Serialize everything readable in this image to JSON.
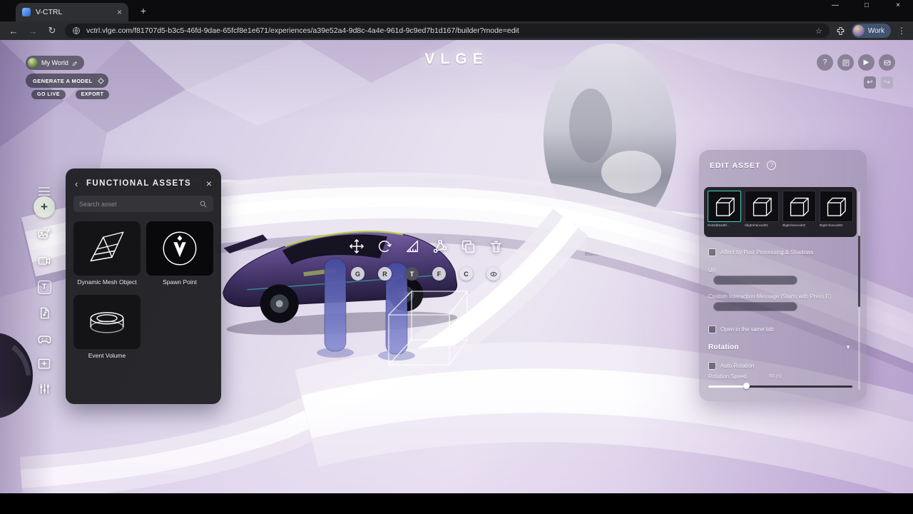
{
  "icons": {
    "close": "×",
    "minimize": "—",
    "maximize": "□",
    "menu_dots": "⋮",
    "back_nav": "←",
    "forward_nav": "→",
    "refresh": "↻",
    "star": "☆",
    "new_tab": "+",
    "back_chevron": "‹",
    "help": "?",
    "play": "▶",
    "undo": "↩",
    "redo": "↪",
    "dropdown": "▼",
    "plus": "+",
    "text_tool": "T"
  },
  "colors": {
    "material_selected_border": "#3fd9c0",
    "slider_fill": "#ffffff",
    "panel_dark": "#1f1f23"
  },
  "browser": {
    "tab_title": "V-CTRL",
    "url": "vctrl.vlge.com/f81707d5-b3c5-46fd-9dae-65fcf8e1e671/experiences/a39e52a4-9d8c-4a4e-961d-9c9ed7b1d167/builder?mode=edit",
    "profile_label": "Work"
  },
  "hud": {
    "world_name": "My World",
    "generate_button": "GENERATE A MODEL",
    "go_live_button": "GO LIVE",
    "export_button": "EXPORT",
    "logo": "VLGE"
  },
  "assets_panel": {
    "title": "FUNCTIONAL ASSETS",
    "search_placeholder": "Search asset",
    "items": [
      "Dynamic Mesh Object",
      "Spawn Point",
      "Event Volume"
    ]
  },
  "gizmo": {
    "letters": [
      "G",
      "R",
      "T",
      "F",
      "C"
    ]
  },
  "edit_panel": {
    "title": "EDIT ASSET",
    "materials": [
      "Rv83db5ad9f...",
      "ItbgEnhanced01",
      "ItbgEnhanced02",
      "ItbgEnhanced03"
    ],
    "affect_label": "Affect by Post Processing & Shadows",
    "url_label": "Url",
    "custom_msg_label": "Custom Interaction Message (Starts with Press E)",
    "open_same_tab_label": "Open in the same tab",
    "rotation_title": "Rotation",
    "auto_rotation_label": "Auto Rotation",
    "rotation_speed_label": "Rotation Speed",
    "rotation_speed_value": "60 (s)"
  }
}
